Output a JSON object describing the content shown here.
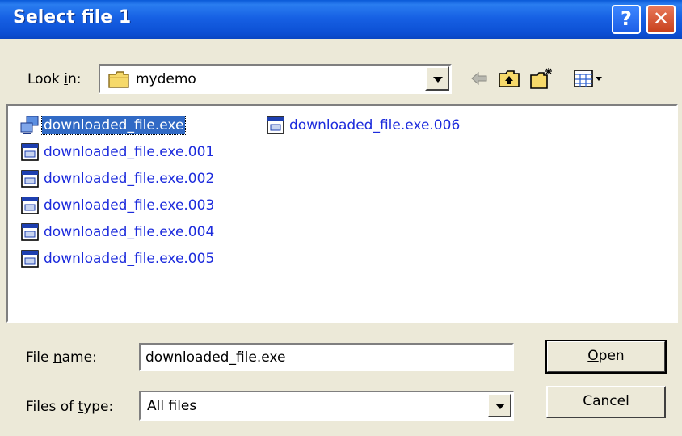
{
  "window": {
    "title": "Select file 1",
    "help_glyph": "?",
    "close_glyph": "✕"
  },
  "lookin": {
    "label_pre": "Look ",
    "label_accel": "i",
    "label_post": "n:",
    "value": "mydemo",
    "icon": "folder-icon"
  },
  "toolbar": {
    "icons": [
      "back-arrow-icon",
      "up-folder-icon",
      "new-folder-icon",
      "view-menu-icon"
    ]
  },
  "files": [
    {
      "name": "downloaded_file.exe",
      "icon": "exe-app-icon",
      "selected": true
    },
    {
      "name": "downloaded_file.exe.001",
      "icon": "window-file-icon"
    },
    {
      "name": "downloaded_file.exe.002",
      "icon": "window-file-icon"
    },
    {
      "name": "downloaded_file.exe.003",
      "icon": "window-file-icon"
    },
    {
      "name": "downloaded_file.exe.004",
      "icon": "window-file-icon"
    },
    {
      "name": "downloaded_file.exe.005",
      "icon": "window-file-icon"
    },
    {
      "name": "downloaded_file.exe.006",
      "icon": "window-file-icon"
    }
  ],
  "filename": {
    "label_pre": "File ",
    "label_accel": "n",
    "label_post": "ame:",
    "value": "downloaded_file.exe"
  },
  "filetype": {
    "label_pre": "Files of ",
    "label_accel": "t",
    "label_post": "ype:",
    "value": "All files"
  },
  "buttons": {
    "open_accel": "O",
    "open_rest": "pen",
    "cancel": "Cancel"
  },
  "colors": {
    "titlebar": "#0c4fd4",
    "file_link": "#1c2bdc",
    "selection": "#316ac5",
    "face": "#ece9d8"
  }
}
